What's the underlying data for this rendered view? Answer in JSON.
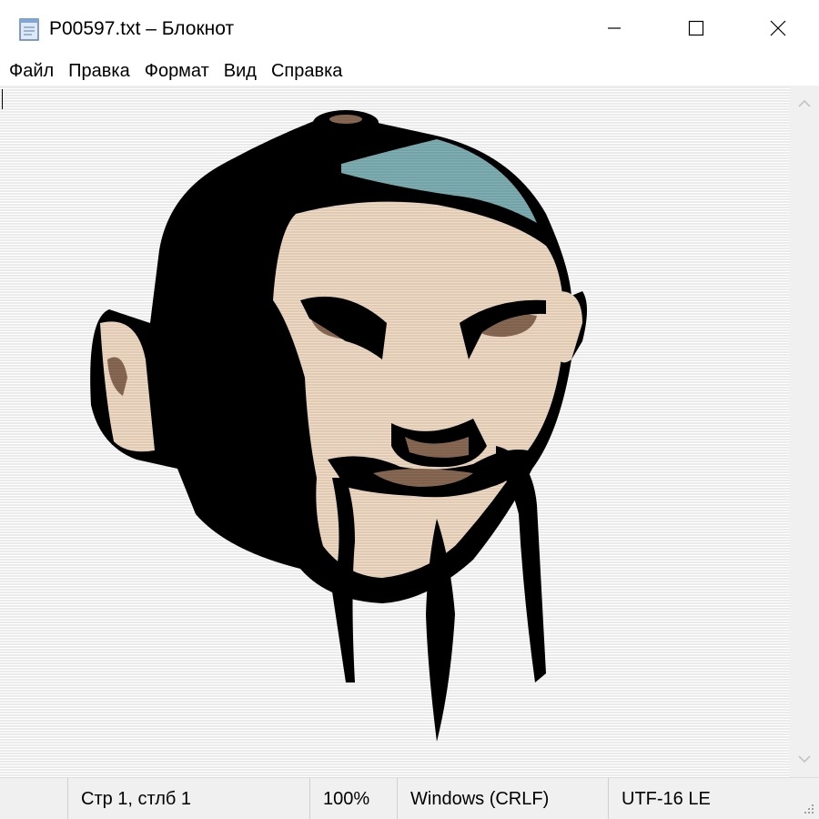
{
  "window": {
    "title": "P00597.txt – Блокнот",
    "icons": {
      "app": "notepad-icon",
      "minimize": "minimize-icon",
      "maximize": "maximize-icon",
      "close": "close-icon"
    }
  },
  "menu": {
    "items": [
      "Файл",
      "Правка",
      "Формат",
      "Вид",
      "Справка"
    ]
  },
  "document": {
    "content_kind": "ascii-art-image",
    "content_description_colors": {
      "outline": "#000000",
      "skin": "#f2dcc6",
      "shadow": "#8a6a55",
      "cap_highlight": "#7fb0b4"
    }
  },
  "status": {
    "position": "Стр 1, стлб 1",
    "zoom": "100%",
    "line_endings": "Windows (CRLF)",
    "encoding": "UTF-16 LE"
  },
  "colors": {
    "titlebar_bg": "#ffffff",
    "statusbar_bg": "#f0f0f0",
    "scrollbar_bg": "#f0f0f0"
  }
}
